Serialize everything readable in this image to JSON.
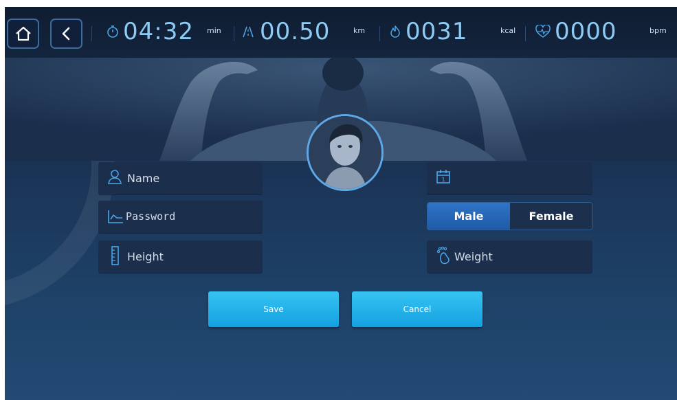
{
  "topbar": {
    "home_icon": "home-icon",
    "back_icon": "back-chevron-icon",
    "time": {
      "value": "04:32",
      "unit": "min",
      "icon": "stopwatch-icon"
    },
    "distance": {
      "value": "00.50",
      "unit": "km",
      "icon": "road-icon"
    },
    "calories": {
      "value": "0031",
      "unit": "kcal",
      "icon": "flame-icon"
    },
    "heart_rate": {
      "value": "0000",
      "unit": "bpm",
      "icon": "heart-pulse-icon"
    }
  },
  "form": {
    "name_placeholder": "Name",
    "password_placeholder": "Password",
    "height_placeholder": "Height",
    "weight_placeholder": "Weight",
    "birthday_value": "",
    "gender": {
      "male": "Male",
      "female": "Female",
      "selected": "Male"
    }
  },
  "actions": {
    "save": "Save",
    "cancel": "Cancel"
  },
  "colors": {
    "accent": "#14a1e0",
    "metric": "#8ecbf4",
    "field": "#1b2e4b",
    "selected_gender": "#2f74c8"
  }
}
